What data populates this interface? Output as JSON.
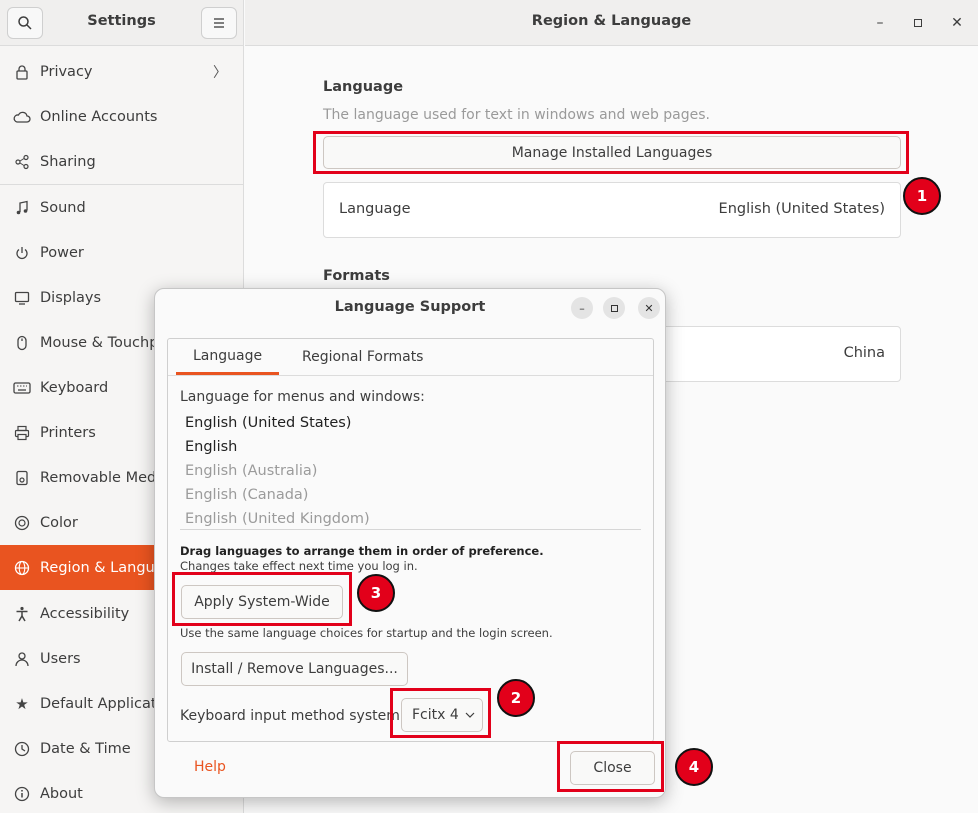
{
  "sidebar": {
    "title": "Settings",
    "items": [
      {
        "label": "Privacy",
        "icon": "lock-icon"
      },
      {
        "label": "Online Accounts",
        "icon": "cloud-icon"
      },
      {
        "label": "Sharing",
        "icon": "share-icon"
      },
      {
        "label": "Sound",
        "icon": "music-note-icon"
      },
      {
        "label": "Power",
        "icon": "power-icon"
      },
      {
        "label": "Displays",
        "icon": "display-icon"
      },
      {
        "label": "Mouse & Touchpad",
        "icon": "mouse-icon"
      },
      {
        "label": "Keyboard",
        "icon": "keyboard-icon"
      },
      {
        "label": "Printers",
        "icon": "printer-icon"
      },
      {
        "label": "Removable Media",
        "icon": "removable-media-icon"
      },
      {
        "label": "Color",
        "icon": "color-icon"
      },
      {
        "label": "Region & Language",
        "icon": "globe-icon"
      },
      {
        "label": "Accessibility",
        "icon": "accessibility-icon"
      },
      {
        "label": "Users",
        "icon": "users-icon"
      },
      {
        "label": "Default Applications",
        "icon": "star-icon"
      },
      {
        "label": "Date & Time",
        "icon": "clock-icon"
      },
      {
        "label": "About",
        "icon": "info-icon"
      }
    ]
  },
  "main": {
    "title": "Region & Language",
    "language_heading": "Language",
    "language_sub": "The language used for text in windows and web pages.",
    "manage_button": "Manage Installed Languages",
    "language_row_key": "Language",
    "language_row_value": "English (United States)",
    "formats_heading": "Formats",
    "formats_value": "China"
  },
  "dialog": {
    "title": "Language Support",
    "tabs": [
      "Language",
      "Regional Formats"
    ],
    "menus_label": "Language for menus and windows:",
    "languages": [
      "English (United States)",
      "English",
      "English (Australia)",
      "English (Canada)",
      "English (United Kingdom)"
    ],
    "drag_hint": "Drag languages to arrange them in order of preference.",
    "effect_hint": "Changes take effect next time you log in.",
    "apply_button": "Apply System-Wide",
    "apply_hint": "Use the same language choices for startup and the login screen.",
    "install_button": "Install / Remove Languages...",
    "input_method_label": "Keyboard input method system:",
    "input_method_value": "Fcitx 4",
    "help_label": "Help",
    "close_button": "Close"
  },
  "annotations": [
    "1",
    "2",
    "3",
    "4"
  ],
  "colors": {
    "accent": "#e95420",
    "annotation": "#e2001a"
  }
}
